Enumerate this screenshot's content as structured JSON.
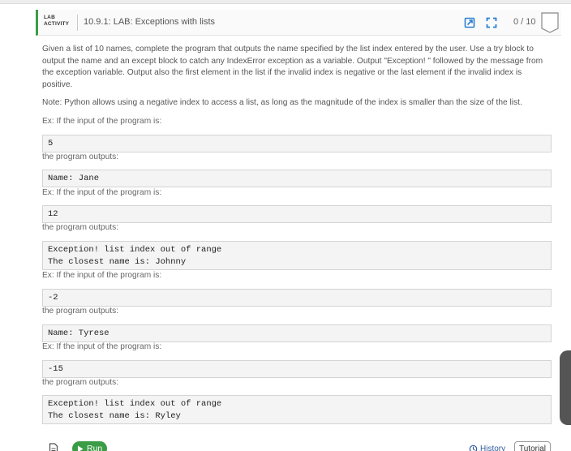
{
  "header": {
    "tag_line1": "LAB",
    "tag_line2": "ACTIVITY",
    "title": "10.9.1: LAB: Exceptions with lists",
    "score": "0 / 10"
  },
  "description": {
    "para1": "Given a list of 10 names, complete the program that outputs the name specified by the list index entered by the user. Use a try block to output the name and an except block to catch any IndexError exception as a variable. Output \"Exception! \" followed by the message from the exception variable. Output also the first element in the list if the invalid index is negative or the last element if the invalid index is positive.",
    "para2": "Note: Python allows using a negative index to access a list, as long as the magnitude of the index is smaller than the size of the list."
  },
  "labels": {
    "input_intro": "Ex: If the input of the program is:",
    "output_intro": "the program outputs:"
  },
  "examples": [
    {
      "input": "5",
      "output": "Name: Jane"
    },
    {
      "input": "12",
      "output": "Exception! list index out of range\nThe closest name is: Johnny"
    },
    {
      "input": "-2",
      "output": "Name: Tyrese"
    },
    {
      "input": "-15",
      "output": "Exception! list index out of range\nThe closest name is: Ryley"
    }
  ],
  "footer": {
    "run_label": "Run",
    "history_label": "History",
    "tutorial_label": "Tutorial"
  },
  "colors": {
    "accent_green": "#3a9d45",
    "link_blue": "#2f5c9e",
    "icon_blue": "#2a7fd4"
  }
}
